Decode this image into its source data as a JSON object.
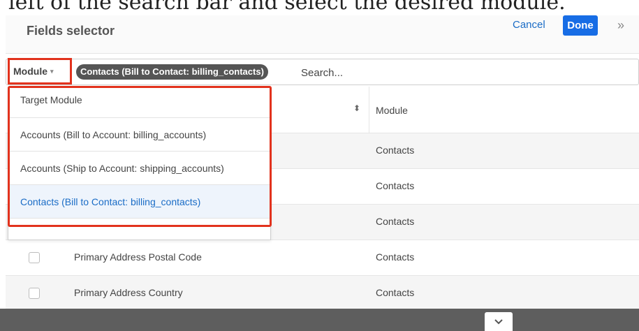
{
  "caption": "left of the search bar and select the desired module.",
  "header": {
    "title": "Fields selector",
    "cancel_label": "Cancel",
    "done_label": "Done",
    "expand_glyph": "»"
  },
  "filter": {
    "module_label": "Module",
    "caret": "▾",
    "selected_pill": "Contacts (Bill to Contact: billing_contacts)",
    "search_placeholder": "Search..."
  },
  "table": {
    "sort_glyph": "⬍",
    "module_header": "Module",
    "rows": [
      {
        "name": "",
        "module": "Contacts"
      },
      {
        "name": "",
        "module": "Contacts"
      },
      {
        "name": "",
        "module": "Contacts"
      },
      {
        "name": "Primary Address Postal Code",
        "module": "Contacts"
      },
      {
        "name": "Primary Address Country",
        "module": "Contacts"
      }
    ]
  },
  "dropdown": {
    "items": [
      "Target Module",
      "Accounts (Bill to Account: billing_accounts)",
      "Accounts (Ship to Account: shipping_accounts)",
      "Contacts (Bill to Contact: billing_contacts)"
    ]
  },
  "colors": {
    "accent": "#176de5",
    "highlight_border": "#e2321d",
    "footer_bg": "#5e5e5e"
  },
  "icons": {
    "sort": "sort-icon",
    "expand": "double-chevron-right-icon",
    "collapse": "chevron-down-icon"
  }
}
